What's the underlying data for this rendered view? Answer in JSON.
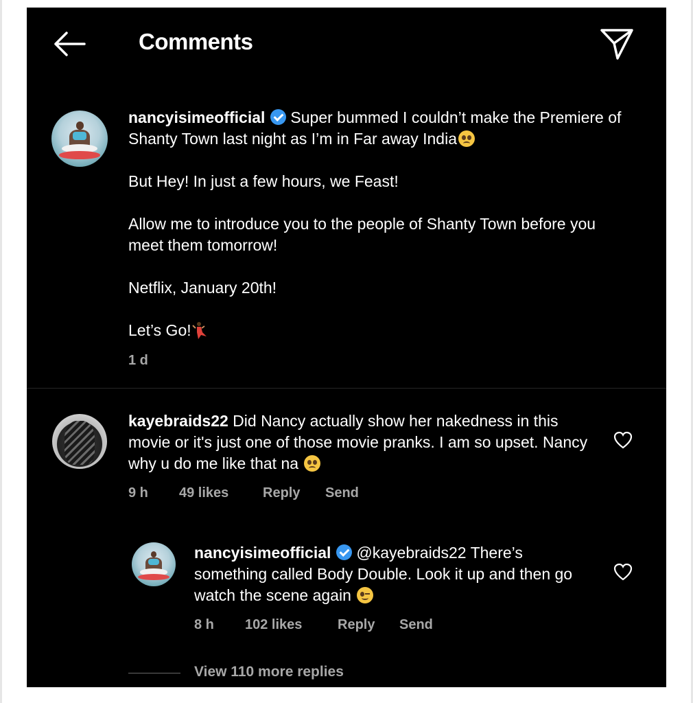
{
  "header": {
    "title": "Comments",
    "back_icon": "arrow-left-icon",
    "send_icon": "paper-plane-icon"
  },
  "caption": {
    "username": "nancyisimeofficial",
    "verified": true,
    "line1": "Super bummed I couldn’t make the Premiere of Shanty Town last night as I’m in Far away India",
    "line1_emoji": "pleading-face-emoji",
    "para2": "But Hey! In just a few hours, we Feast!",
    "para3": "Allow me to introduce you to the people of Shanty Town before you meet them tomorrow!",
    "para4": "Netflix, January 20th!",
    "para5": "Let’s Go!",
    "para5_emoji": "dancer-emoji",
    "time": "1 d"
  },
  "comments": [
    {
      "username": "kayebraids22",
      "text": "Did Nancy actually show her nakedness in this movie or it's just one of those movie pranks. I am so upset. Nancy why u do me like that na",
      "emoji": "sad-face-emoji",
      "time": "9 h",
      "likes": "49 likes",
      "reply_label": "Reply",
      "send_label": "Send"
    }
  ],
  "reply": {
    "username": "nancyisimeofficial",
    "verified": true,
    "mention": "@kayebraids22",
    "text": "There’s something called Body Double. Look it up and then go watch the scene again",
    "emoji": "winking-face-emoji",
    "time": "8 h",
    "likes": "102 likes",
    "reply_label": "Reply",
    "send_label": "Send"
  },
  "view_more": "View 110 more replies",
  "colors": {
    "background": "#000000",
    "text": "#ffffff",
    "muted": "#a8a8a8",
    "verified": "#3897f0"
  }
}
